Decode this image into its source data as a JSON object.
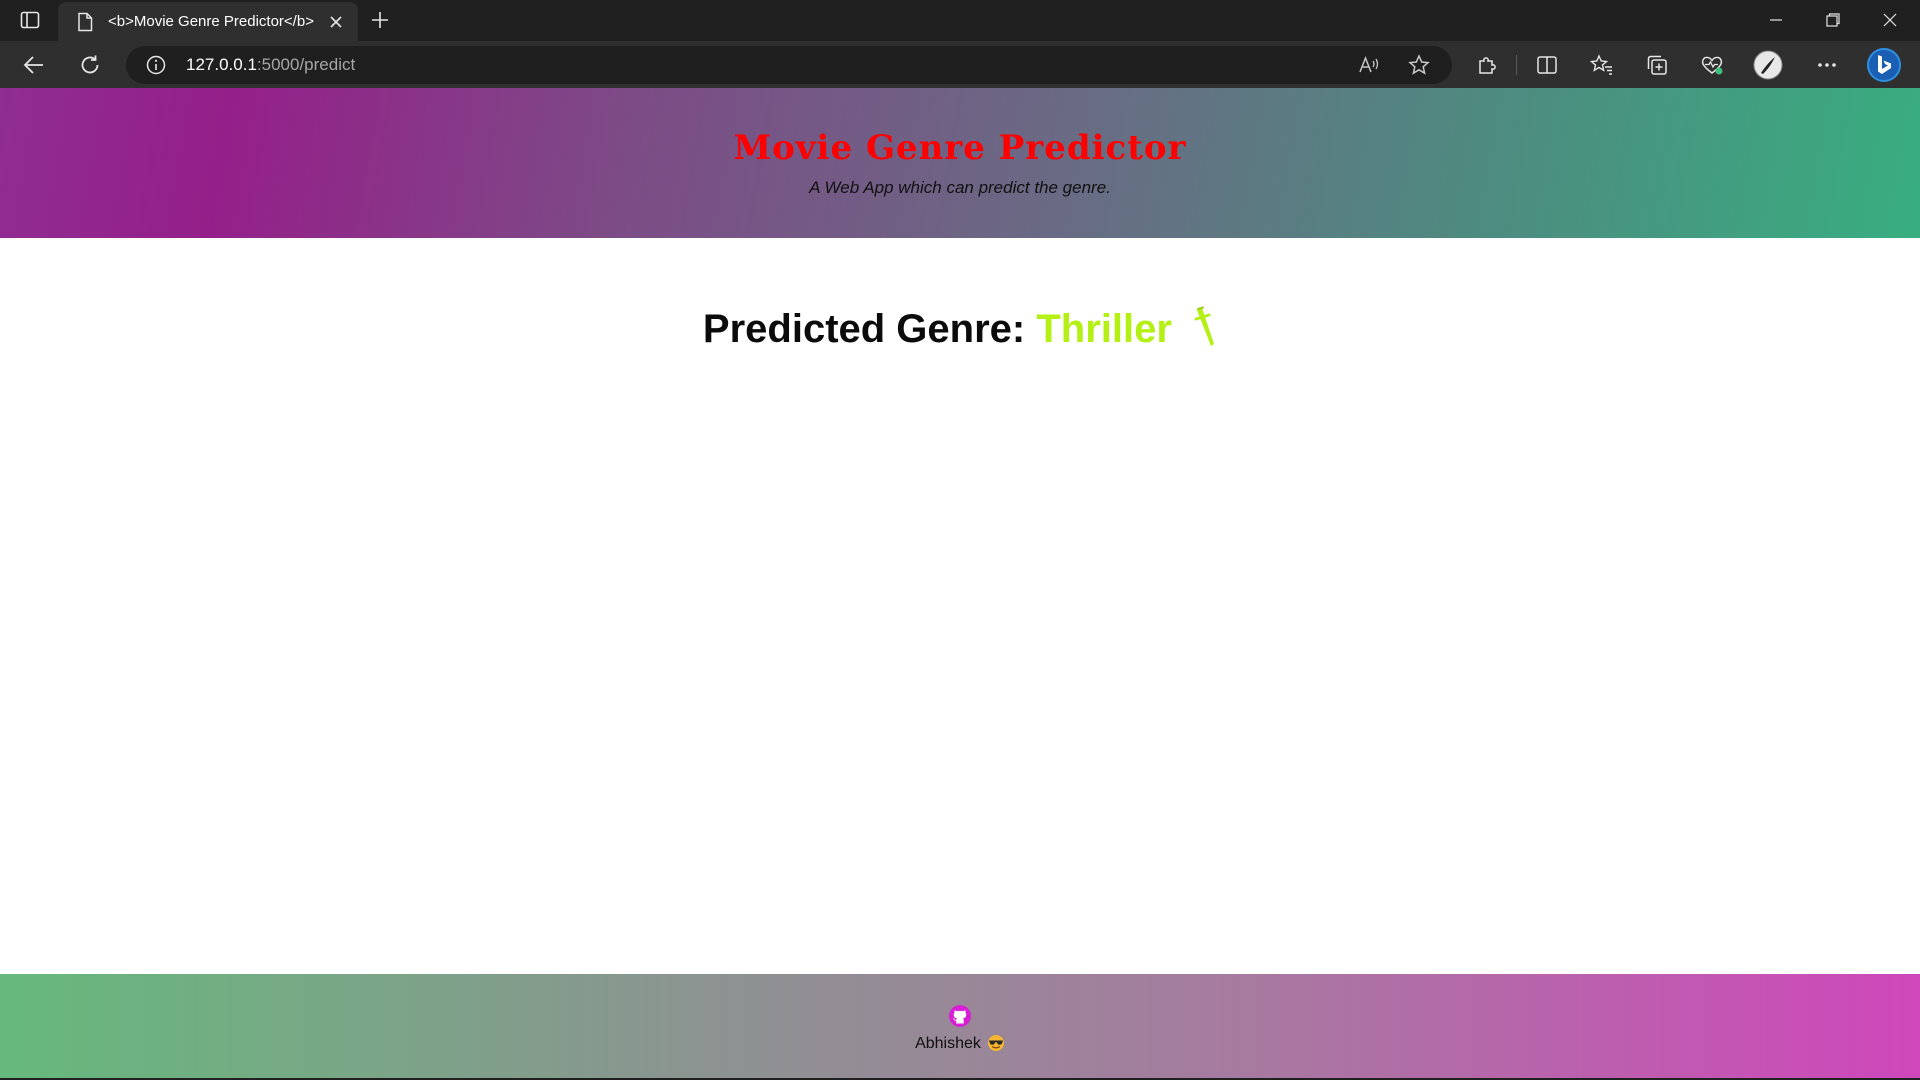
{
  "browser": {
    "tab_title": "<b>Movie Genre Predictor</b>",
    "url_host": "127.0.0.1",
    "url_path": ":5000/predict"
  },
  "header": {
    "title": "Movie Genre Predictor",
    "subtitle": "A Web App which can predict the genre."
  },
  "result": {
    "label": "Predicted Genre:",
    "genre": "Thriller",
    "genre_icon": "dagger-icon",
    "genre_color": "#b4f014"
  },
  "footer": {
    "icon": "github-icon",
    "author": "Abhishek",
    "emoji": "smiling-face-with-sunglasses"
  },
  "colors": {
    "title": "#ff0000",
    "header_gradient": [
      "#951f8a",
      "#38ae80"
    ],
    "footer_gradient": [
      "#66b97c",
      "#cf47bb"
    ]
  }
}
